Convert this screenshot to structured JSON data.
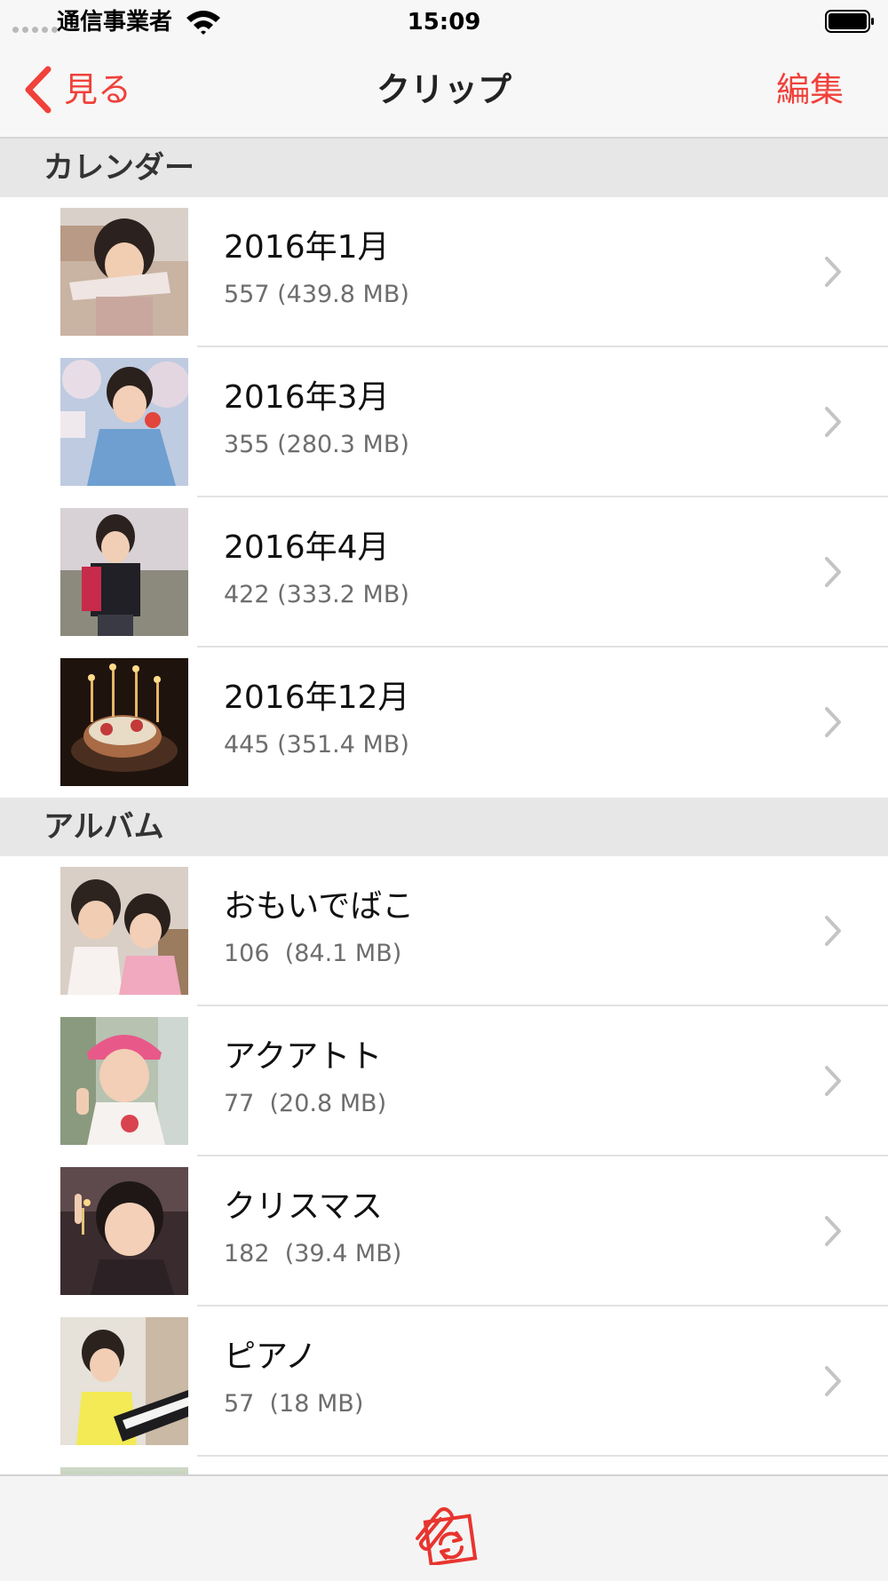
{
  "status_bar": {
    "carrier": "通信事業者",
    "time": "15:09"
  },
  "nav": {
    "back_label": "見る",
    "title": "クリップ",
    "edit_label": "編集"
  },
  "sections": [
    {
      "title": "カレンダー",
      "items": [
        {
          "title": "2016年1月",
          "subtitle": "557 (439.8 MB)"
        },
        {
          "title": "2016年3月",
          "subtitle": "355 (280.3 MB)"
        },
        {
          "title": "2016年4月",
          "subtitle": "422 (333.2 MB)"
        },
        {
          "title": "2016年12月",
          "subtitle": "445 (351.4 MB)"
        }
      ]
    },
    {
      "title": "アルバム",
      "items": [
        {
          "title": "おもいでばこ",
          "subtitle": "106  (84.1 MB)"
        },
        {
          "title": "アクアトト",
          "subtitle": "77  (20.8 MB)"
        },
        {
          "title": "クリスマス",
          "subtitle": "182  (39.4 MB)"
        },
        {
          "title": "ピアノ",
          "subtitle": "57  (18 MB)"
        }
      ]
    }
  ],
  "colors": {
    "accent": "#f0413a",
    "section_bg": "#e7e7e7",
    "bar_bg": "#f7f7f7"
  },
  "icons": {
    "back": "chevron-left-icon",
    "row": "chevron-right-icon",
    "tab": "clip-sync-icon"
  }
}
